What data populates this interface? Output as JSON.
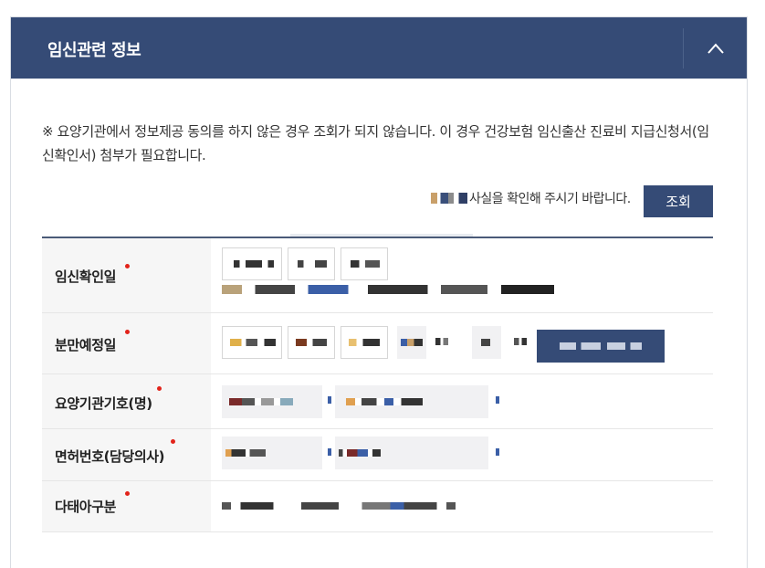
{
  "panel": {
    "title": "임신관련 정보",
    "collapse_icon": "chevron-up-icon"
  },
  "notice": "※ 요양기관에서 정보제공 동의를 하지 않은 경우 조회가 되지 않습니다. 이 경우 건강보험 임신출산 진료비 지급신청서(임신확인서) 첨부가 필요합니다.",
  "confirm": {
    "text": "사실을 확인해 주시기 바랍니다.",
    "search_button": "조회"
  },
  "rows": [
    {
      "label": "임신확인일"
    },
    {
      "label": "분만예정일"
    },
    {
      "label": "요양기관기호(명)"
    },
    {
      "label": "면허번호(담당의사)"
    },
    {
      "label": "다태아구분"
    }
  ],
  "colors": {
    "primary": "#354b76",
    "required": "#e2231a",
    "label_bg": "#f6f6f6"
  }
}
